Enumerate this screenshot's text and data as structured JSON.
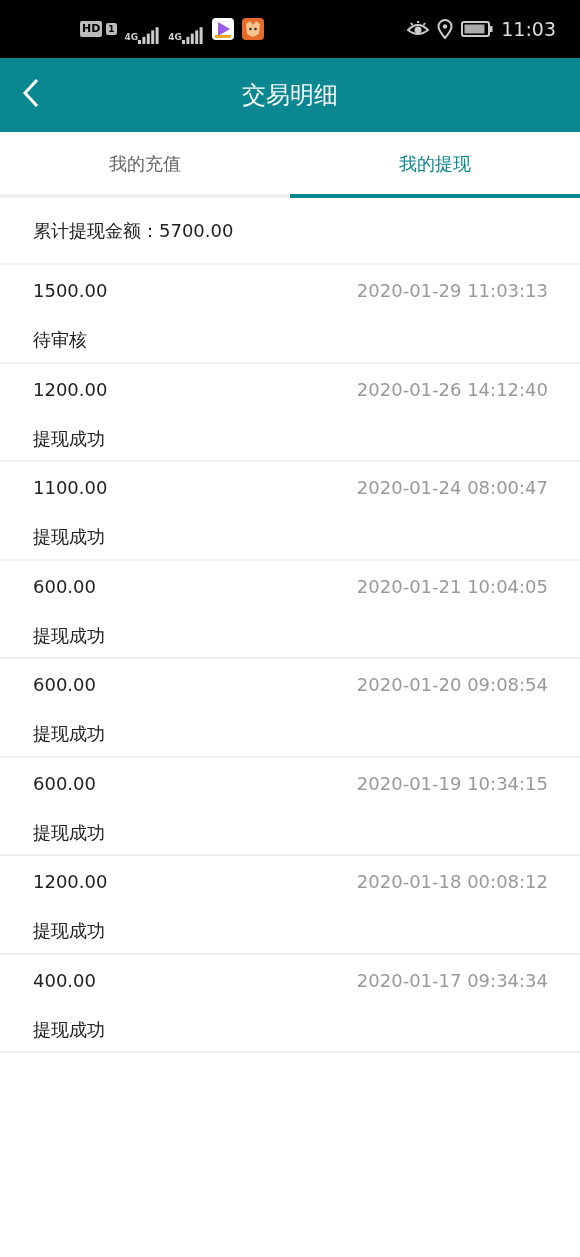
{
  "status_bar": {
    "hd": "HD",
    "sim": "1",
    "networks": [
      "4G",
      "4G"
    ],
    "time": "11:03"
  },
  "header": {
    "title": "交易明细"
  },
  "tabs": [
    {
      "label": "我的充值",
      "selected": false
    },
    {
      "label": "我的提现",
      "selected": true
    }
  ],
  "summary": "累计提现金额：5700.00",
  "records": [
    {
      "amount": "1500.00",
      "time": "2020-01-29 11:03:13",
      "status": "待审核"
    },
    {
      "amount": "1200.00",
      "time": "2020-01-26 14:12:40",
      "status": "提现成功"
    },
    {
      "amount": "1100.00",
      "time": "2020-01-24 08:00:47",
      "status": "提现成功"
    },
    {
      "amount": "600.00",
      "time": "2020-01-21 10:04:05",
      "status": "提现成功"
    },
    {
      "amount": "600.00",
      "time": "2020-01-20 09:08:54",
      "status": "提现成功"
    },
    {
      "amount": "600.00",
      "time": "2020-01-19 10:34:15",
      "status": "提现成功"
    },
    {
      "amount": "1200.00",
      "time": "2020-01-18 00:08:12",
      "status": "提现成功"
    },
    {
      "amount": "400.00",
      "time": "2020-01-17 09:34:34",
      "status": "提现成功"
    }
  ]
}
